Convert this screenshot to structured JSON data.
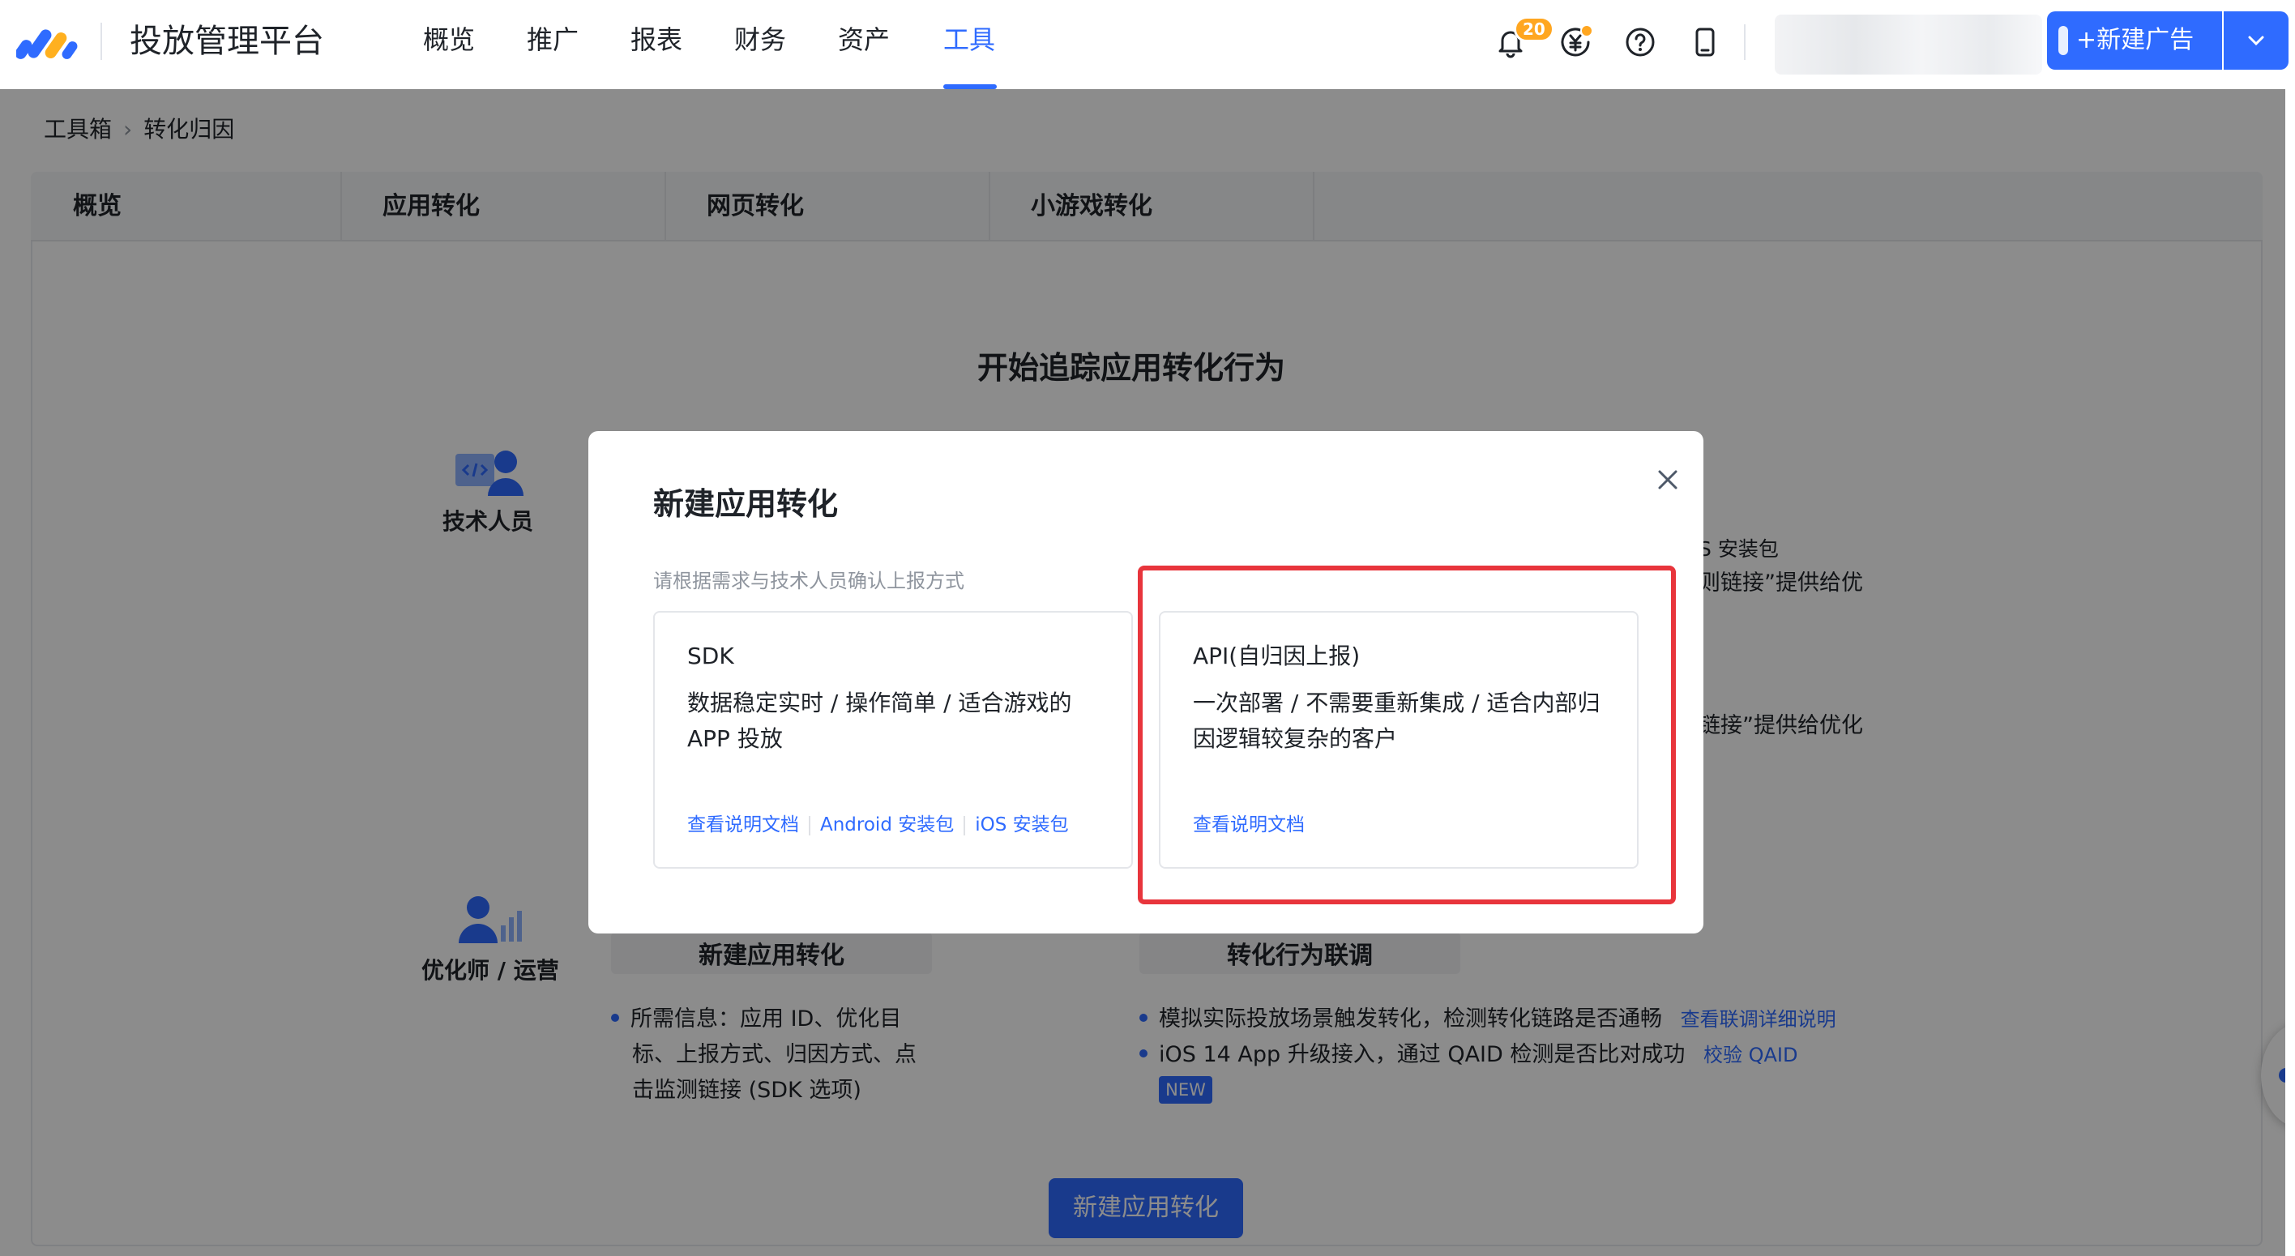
{
  "header": {
    "brand": "投放管理平台",
    "nav": [
      "概览",
      "推广",
      "报表",
      "财务",
      "资产",
      "工具"
    ],
    "active_nav": "工具",
    "notification_count": "20",
    "icons": [
      "bell-icon",
      "yuan-coin-icon",
      "help-circle-icon",
      "mobile-icon"
    ],
    "new_ad_label": "+新建广告",
    "colors": {
      "accent": "#2f6bff",
      "badge": "#ffa620"
    }
  },
  "breadcrumb": {
    "items": [
      "工具箱",
      "转化归因"
    ]
  },
  "subtabs": [
    "概览",
    "应用转化",
    "网页转化",
    "小游戏转化"
  ],
  "page": {
    "title": "开始追踪应用转化行为",
    "roles": {
      "tech": "技术人员",
      "optimizer": "优化师 / 运营"
    },
    "fragment_ios_pkg": "S 安装包",
    "fragment_link_1": "则链接”提供给优",
    "fragment_link_2": "链接”提供给优化",
    "step_new_app_conversion": "新建应用转化",
    "step_joint_debug": "转化行为联调",
    "required_info": {
      "label": "所需信息：",
      "lines": [
        "应用 ID、优化目",
        "标、上报方式、归因方式、点",
        "击监测链接 (SDK 选项)"
      ]
    },
    "debug_bullets": [
      {
        "text": "模拟实际投放场景触发转化，检测转化链路是否通畅",
        "link": "查看联调详细说明"
      },
      {
        "text": "iOS 14 App 升级接入，通过 QAID 检测是否比对成功",
        "link": "校验 QAID"
      }
    ],
    "new_tag": "NEW",
    "primary_button": "新建应用转化"
  },
  "modal": {
    "title": "新建应用转化",
    "hint": "请根据需求与技术人员确认上报方式",
    "options": [
      {
        "title": "SDK",
        "desc_lines": [
          "数据稳定实时 / 操作简单 / 适合游戏的",
          "APP 投放"
        ],
        "links": [
          "查看说明文档",
          "Android 安装包",
          "iOS 安装包"
        ]
      },
      {
        "title": "API(自归因上报)",
        "desc_lines": [
          "一次部署 / 不需要重新集成 / 适合内部归",
          "因逻辑较复杂的客户"
        ],
        "links": [
          "查看说明文档"
        ]
      }
    ],
    "highlight_color": "#e8353c"
  }
}
